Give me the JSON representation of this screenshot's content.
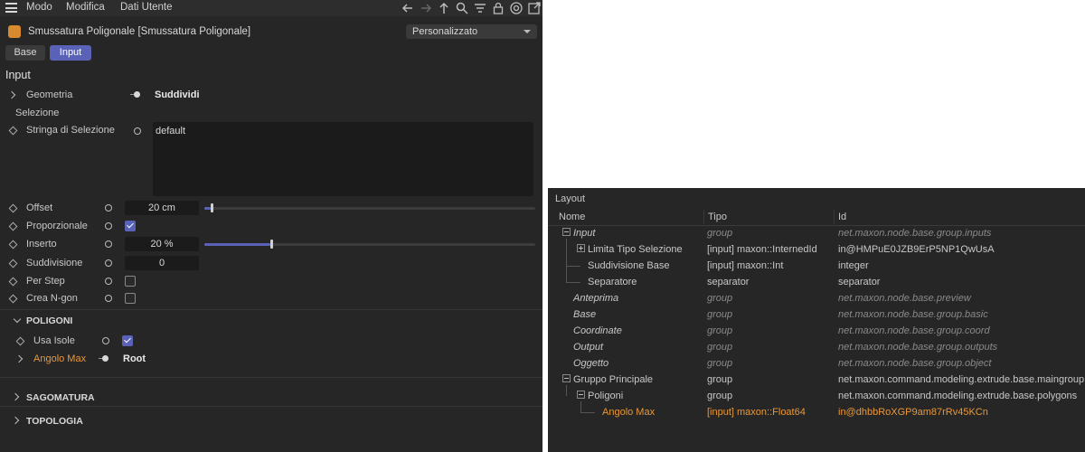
{
  "menu": {
    "items": [
      "Modo",
      "Modifica",
      "Dati Utente"
    ]
  },
  "object": {
    "title": "Smussatura Poligonale [Smussatura Poligonale]",
    "preset": "Personalizzato"
  },
  "tabs": [
    {
      "label": "Base",
      "active": false
    },
    {
      "label": "Input",
      "active": true
    }
  ],
  "section_title": "Input",
  "params": {
    "geometria": {
      "label": "Geometria",
      "value": "Suddividi"
    },
    "selezione_label": "Selezione",
    "stringa": {
      "label": "Stringa di Selezione",
      "value": "default"
    },
    "offset": {
      "label": "Offset",
      "value": "20 cm",
      "slider_fraction": 0.02
    },
    "proporzionale": {
      "label": "Proporzionale",
      "checked": true
    },
    "inserto": {
      "label": "Inserto",
      "value": "20 %",
      "slider_fraction": 0.2
    },
    "suddivisione": {
      "label": "Suddivisione",
      "value": "0"
    },
    "per_step": {
      "label": "Per Step",
      "checked": false
    },
    "crea_ngon": {
      "label": "Crea N-gon",
      "checked": false
    }
  },
  "groups": {
    "poligoni": {
      "label": "POLIGONI"
    },
    "usa_isole": {
      "label": "Usa Isole",
      "checked": true
    },
    "angolo_max": {
      "label": "Angolo Max",
      "value": "Root"
    },
    "sagomatura": {
      "label": "SAGOMATURA"
    },
    "topologia": {
      "label": "TOPOLOGIA"
    }
  },
  "layout": {
    "title": "Layout",
    "columns": [
      "Nome",
      "Tipo",
      "Id"
    ],
    "rows": [
      {
        "nome": "Input",
        "tipo": "group",
        "id": "net.maxon.node.base.group.inputs"
      },
      {
        "nome": "Limita Tipo Selezione",
        "tipo": "[input] maxon::InternedId",
        "id": "in@HMPuE0JZB9ErP5NP1QwUsA"
      },
      {
        "nome": "Suddivisione Base",
        "tipo": "[input] maxon::Int",
        "id": "integer"
      },
      {
        "nome": "Separatore",
        "tipo": "separator",
        "id": "separator"
      },
      {
        "nome": "Anteprima",
        "tipo": "group",
        "id": "net.maxon.node.base.preview"
      },
      {
        "nome": "Base",
        "tipo": "group",
        "id": "net.maxon.node.base.group.basic"
      },
      {
        "nome": "Coordinate",
        "tipo": "group",
        "id": "net.maxon.node.base.group.coord"
      },
      {
        "nome": "Output",
        "tipo": "group",
        "id": "net.maxon.node.base.group.outputs"
      },
      {
        "nome": "Oggetto",
        "tipo": "group",
        "id": "net.maxon.node.base.group.object"
      },
      {
        "nome": "Gruppo Principale",
        "tipo": "group",
        "id": "net.maxon.command.modeling.extrude.base.maingroup"
      },
      {
        "nome": "Poligoni",
        "tipo": "group",
        "id": "net.maxon.command.modeling.extrude.base.polygons"
      },
      {
        "nome": "Angolo Max",
        "tipo": "[input] maxon::Float64",
        "id": "in@dhbbRoXGP9am87rRv45KCn"
      }
    ]
  },
  "colors": {
    "accent": "#5a62b8",
    "highlight": "#e9983a",
    "panel": "#262626"
  }
}
